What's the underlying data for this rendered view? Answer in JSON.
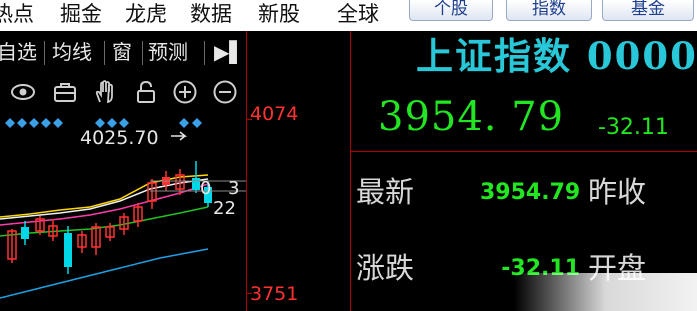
{
  "menu": {
    "items": [
      "热点",
      "掘金",
      "龙虎",
      "数据",
      "新股",
      "全球"
    ],
    "buttons": [
      "个股",
      "指数",
      "基金"
    ]
  },
  "chart_toolbar": {
    "items": [
      "自选",
      "均线",
      "窗",
      "预测"
    ],
    "collapse_glyph": "▶▌"
  },
  "chart_icons": [
    "eye-icon",
    "briefcase-icon",
    "hand-icon",
    "lock-icon",
    "zoom-in-icon",
    "zoom-out-icon"
  ],
  "chart": {
    "high_annotation": "4025.70",
    "ma_labels": [
      "0",
      "3",
      "22"
    ],
    "axis_top": "4074",
    "axis_bottom": "3751",
    "colors": {
      "up": "#ff3232",
      "down": "#00d8e8",
      "axis": "#b00000"
    }
  },
  "quote": {
    "name": "上证指数",
    "code": "0000",
    "price": "3954. 79",
    "change": "-32.11",
    "rows": [
      {
        "label": "最新",
        "value": "3954.79",
        "label2": "昨收"
      },
      {
        "label": "涨跌",
        "value": "-32.11",
        "label2": "开盘"
      }
    ],
    "colors": {
      "name": "#28c8d8",
      "down": "#22e622"
    }
  }
}
